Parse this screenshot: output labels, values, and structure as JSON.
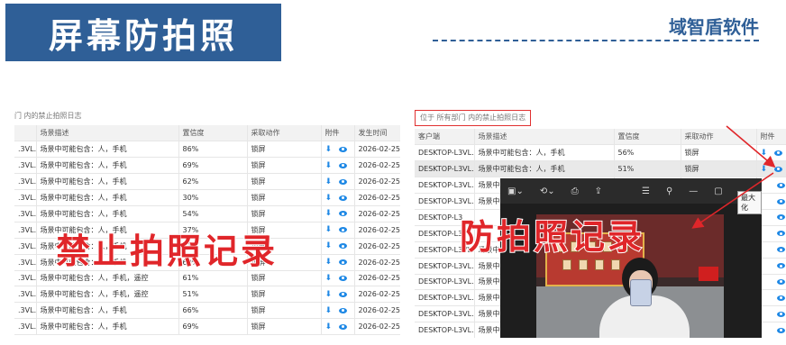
{
  "header": {
    "title": "屏幕防拍照",
    "brand": "域智盾软件"
  },
  "left_panel": {
    "breadcrumb": "门 内的禁止拍照日志",
    "columns": [
      "",
      "场景描述",
      "置信度",
      "采取动作",
      "附件",
      "发生时间"
    ],
    "rows": [
      {
        "client": ".3VL...",
        "desc": "场景中可能包含：人，手机",
        "conf": "86%",
        "action": "锁屏",
        "time": "2026-02-25 1"
      },
      {
        "client": ".3VL...",
        "desc": "场景中可能包含：人，手机",
        "conf": "69%",
        "action": "锁屏",
        "time": "2026-02-25 1"
      },
      {
        "client": ".3VL...",
        "desc": "场景中可能包含：人，手机",
        "conf": "62%",
        "action": "锁屏",
        "time": "2026-02-25 1"
      },
      {
        "client": ".3VL...",
        "desc": "场景中可能包含：人，手机",
        "conf": "30%",
        "action": "锁屏",
        "time": "2026-02-25 1"
      },
      {
        "client": ".3VL...",
        "desc": "场景中可能包含：人，手机",
        "conf": "54%",
        "action": "锁屏",
        "time": "2026-02-25 1"
      },
      {
        "client": ".3VL...",
        "desc": "场景中可能包含：人，手机",
        "conf": "37%",
        "action": "锁屏",
        "time": "2026-02-25 1"
      },
      {
        "client": ".3VL...",
        "desc": "场景中可能包含：人，手机",
        "conf": "71%",
        "action": "锁屏",
        "time": "2026-02-25 1"
      },
      {
        "client": ".3VL...",
        "desc": "场景中可能包含：人，手机",
        "conf": "60%",
        "action": "锁屏",
        "time": "2026-02-25 1"
      },
      {
        "client": ".3VL...",
        "desc": "场景中可能包含：人，手机，遥控",
        "conf": "61%",
        "action": "锁屏",
        "time": "2026-02-25 1"
      },
      {
        "client": ".3VL...",
        "desc": "场景中可能包含：人，手机，遥控",
        "conf": "51%",
        "action": "锁屏",
        "time": "2026-02-25 1"
      },
      {
        "client": ".3VL...",
        "desc": "场景中可能包含：人，手机",
        "conf": "66%",
        "action": "锁屏",
        "time": "2026-02-25 1"
      },
      {
        "client": ".3VL...",
        "desc": "场景中可能包含：人，手机",
        "conf": "69%",
        "action": "锁屏",
        "time": "2026-02-25 1"
      }
    ],
    "overlay": "禁止拍照记录"
  },
  "right_panel": {
    "breadcrumb": "位于 所有部门 内的禁止拍照日志",
    "columns": [
      "客户端",
      "场景描述",
      "置信度",
      "采取动作",
      "附件"
    ],
    "rows": [
      {
        "client": "DESKTOP-L3VL...",
        "desc": "场景中可能包含：人，手机",
        "conf": "56%",
        "action": "锁屏"
      },
      {
        "client": "DESKTOP-L3VL...",
        "desc": "场景中可能包含：人，手机",
        "conf": "51%",
        "action": "锁屏"
      },
      {
        "client": "DESKTOP-L3VL...",
        "desc": "场景中可",
        "conf": "",
        "action": ""
      },
      {
        "client": "DESKTOP-L3VL...",
        "desc": "场景中可",
        "conf": "",
        "action": ""
      },
      {
        "client": "DESKTOP-L3",
        "desc": "",
        "conf": "",
        "action": ""
      },
      {
        "client": "DESKTOP-L3",
        "desc": "",
        "conf": "",
        "action": ""
      },
      {
        "client": "DESKTOP-L3VL...",
        "desc": "场景中可",
        "conf": "",
        "action": ""
      },
      {
        "client": "DESKTOP-L3VL...",
        "desc": "场景中可",
        "conf": "",
        "action": ""
      },
      {
        "client": "DESKTOP-L3VL...",
        "desc": "场景中可",
        "conf": "",
        "action": ""
      },
      {
        "client": "DESKTOP-L3VL...",
        "desc": "场景中可",
        "conf": "",
        "action": ""
      },
      {
        "client": "DESKTOP-L3VL...",
        "desc": "场景中可",
        "conf": "",
        "action": ""
      },
      {
        "client": "DESKTOP-L3VL...",
        "desc": "场景中可",
        "conf": "",
        "action": ""
      }
    ],
    "highlight_row": 1,
    "overlay": "防拍照记录"
  },
  "viewer": {
    "tooltip": "最大化"
  },
  "colors": {
    "banner": "#2f5f97",
    "accent_red": "#e0262a",
    "link_blue": "#1e88e5"
  }
}
